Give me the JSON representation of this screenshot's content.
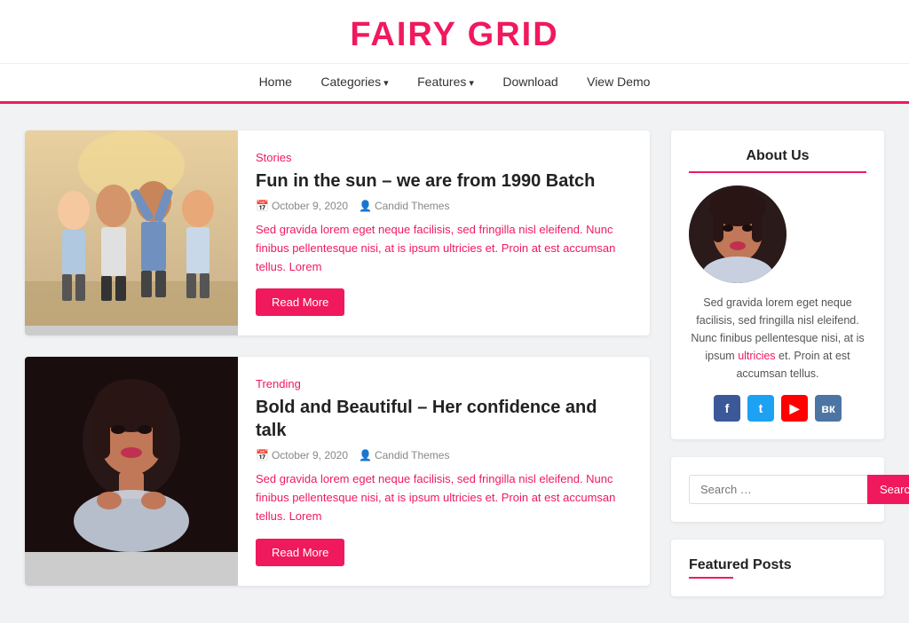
{
  "site": {
    "title": "FAIRY GRID"
  },
  "nav": {
    "items": [
      {
        "label": "Home",
        "url": "#",
        "hasArrow": false
      },
      {
        "label": "Categories",
        "url": "#",
        "hasArrow": true
      },
      {
        "label": "Features",
        "url": "#",
        "hasArrow": true
      },
      {
        "label": "Download",
        "url": "#",
        "hasArrow": false
      },
      {
        "label": "View Demo",
        "url": "#",
        "hasArrow": false
      }
    ]
  },
  "posts": [
    {
      "category": "Stories",
      "title": "Fun in the sun – we are from 1990 Batch",
      "date": "October 9, 2020",
      "author": "Candid Themes",
      "excerpt": "Sed gravida lorem eget neque facilisis, sed fringilla nisl eleifend. Nunc finibus pellentesque nisi, at is ipsum ultricies et. Proin at est accumsan tellus. Lorem",
      "readMore": "Read More",
      "type": "group"
    },
    {
      "category": "Trending",
      "title": "Bold and Beautiful – Her confidence and talk",
      "date": "October 9, 2020",
      "author": "Candid Themes",
      "excerpt": "Sed gravida lorem eget neque facilisis, sed fringilla nisl eleifend. Nunc finibus pellentesque nisi, at is ipsum ultricies et. Proin at est accumsan tellus. Lorem",
      "readMore": "Read More",
      "type": "portrait"
    }
  ],
  "sidebar": {
    "about": {
      "title": "About Us",
      "text": "Sed gravida lorem eget neque facilisis, sed fringilla nisl eleifend. Nunc finibus pellentesque nisi, at is ipsum ",
      "textLink": "ultricies",
      "textEnd": " et. Proin at est accumsan tellus."
    },
    "social": [
      {
        "name": "facebook",
        "label": "f",
        "class": "si-fb"
      },
      {
        "name": "twitter",
        "label": "t",
        "class": "si-tw"
      },
      {
        "name": "youtube",
        "label": "▶",
        "class": "si-yt"
      },
      {
        "name": "vk",
        "label": "вк",
        "class": "si-vk"
      }
    ],
    "search": {
      "placeholder": "Search …",
      "buttonLabel": "Search"
    },
    "featured": {
      "title": "Featured Posts"
    }
  }
}
